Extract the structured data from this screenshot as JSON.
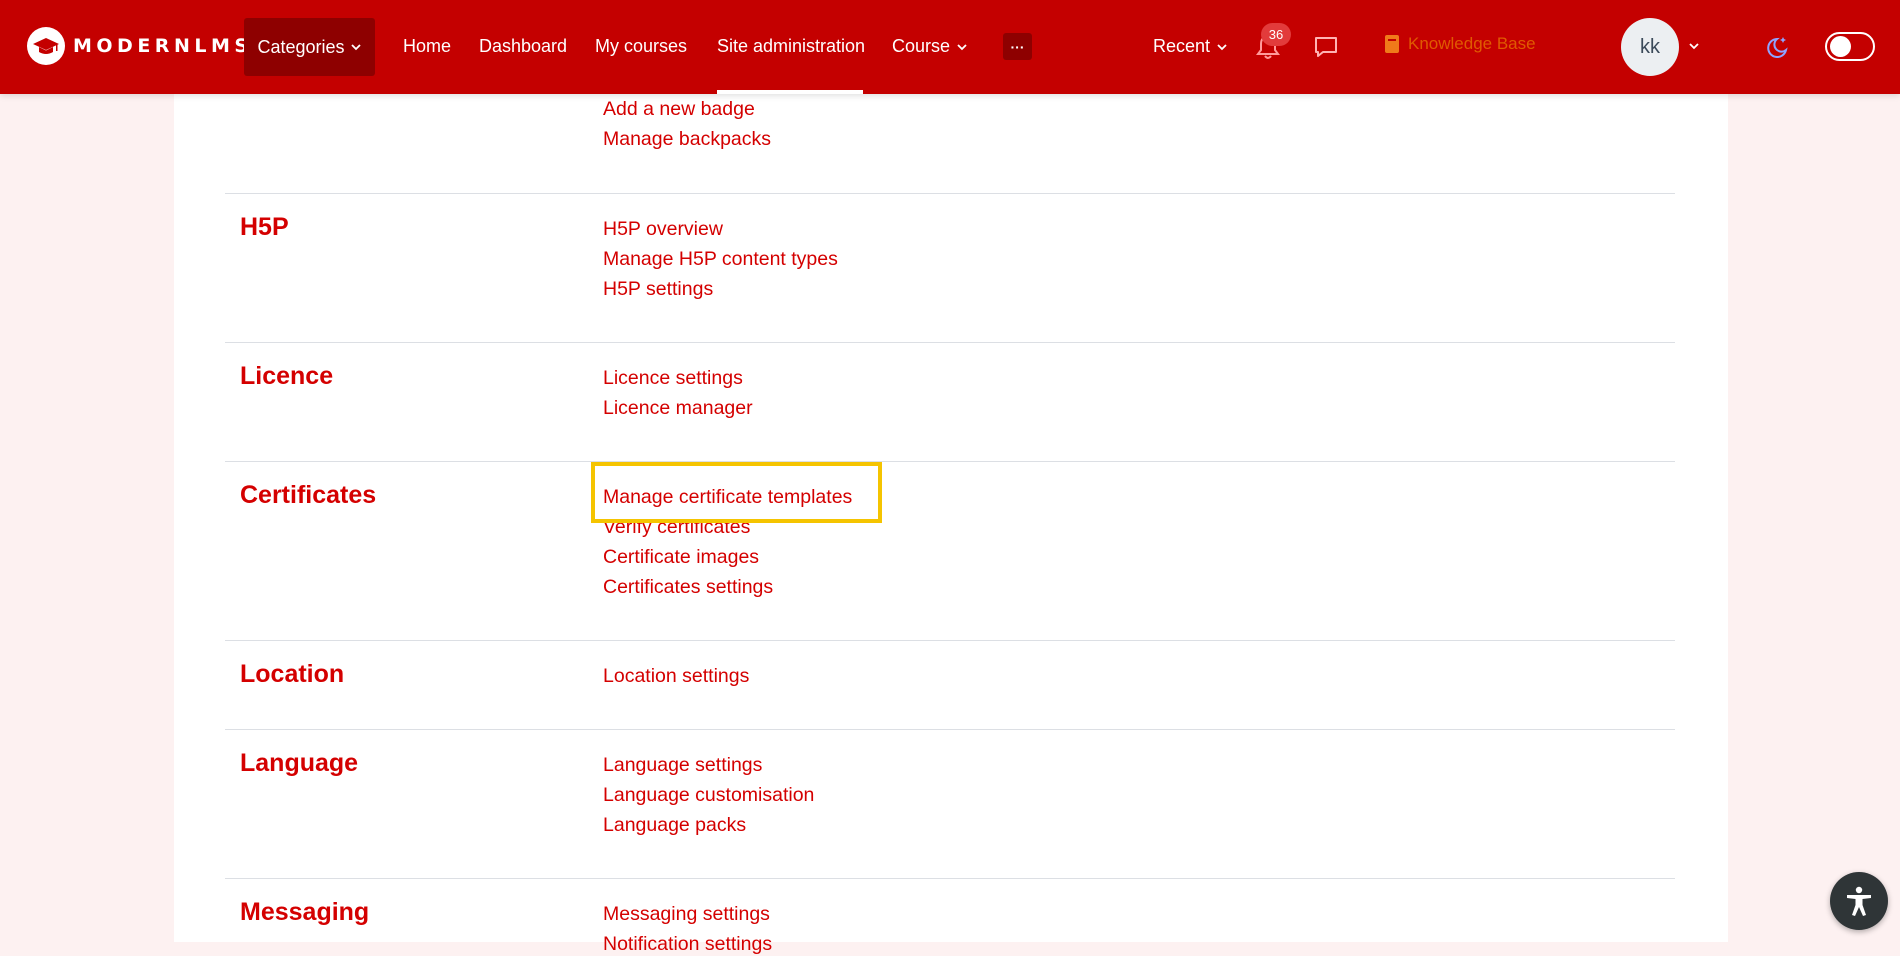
{
  "header": {
    "logo_text": "MODERNLMS",
    "categories_label": "Categories",
    "nav": {
      "home": "Home",
      "dashboard": "Dashboard",
      "my_courses": "My courses",
      "site_administration": "Site administration",
      "course": "Course",
      "more": "···",
      "recent": "Recent"
    },
    "notifications_count": "36",
    "knowledge_base": "Knowledge Base",
    "avatar_initials": "kk",
    "accent_color": "#c40000"
  },
  "sections": {
    "badges": {
      "links": [
        "Add a new badge",
        "Manage backpacks"
      ]
    },
    "h5p": {
      "title": "H5P",
      "links": [
        "H5P overview",
        "Manage H5P content types",
        "H5P settings"
      ]
    },
    "licence": {
      "title": "Licence",
      "links": [
        "Licence settings",
        "Licence manager"
      ]
    },
    "certificates": {
      "title": "Certificates",
      "links": [
        "Manage certificate templates",
        "Verify certificates",
        "Certificate images",
        "Certificates settings"
      ]
    },
    "location": {
      "title": "Location",
      "links": [
        "Location settings"
      ]
    },
    "language": {
      "title": "Language",
      "links": [
        "Language settings",
        "Language customisation",
        "Language packs"
      ]
    },
    "messaging": {
      "title": "Messaging",
      "links": [
        "Messaging settings",
        "Notification settings"
      ]
    }
  },
  "highlight_color": "#f5c400"
}
